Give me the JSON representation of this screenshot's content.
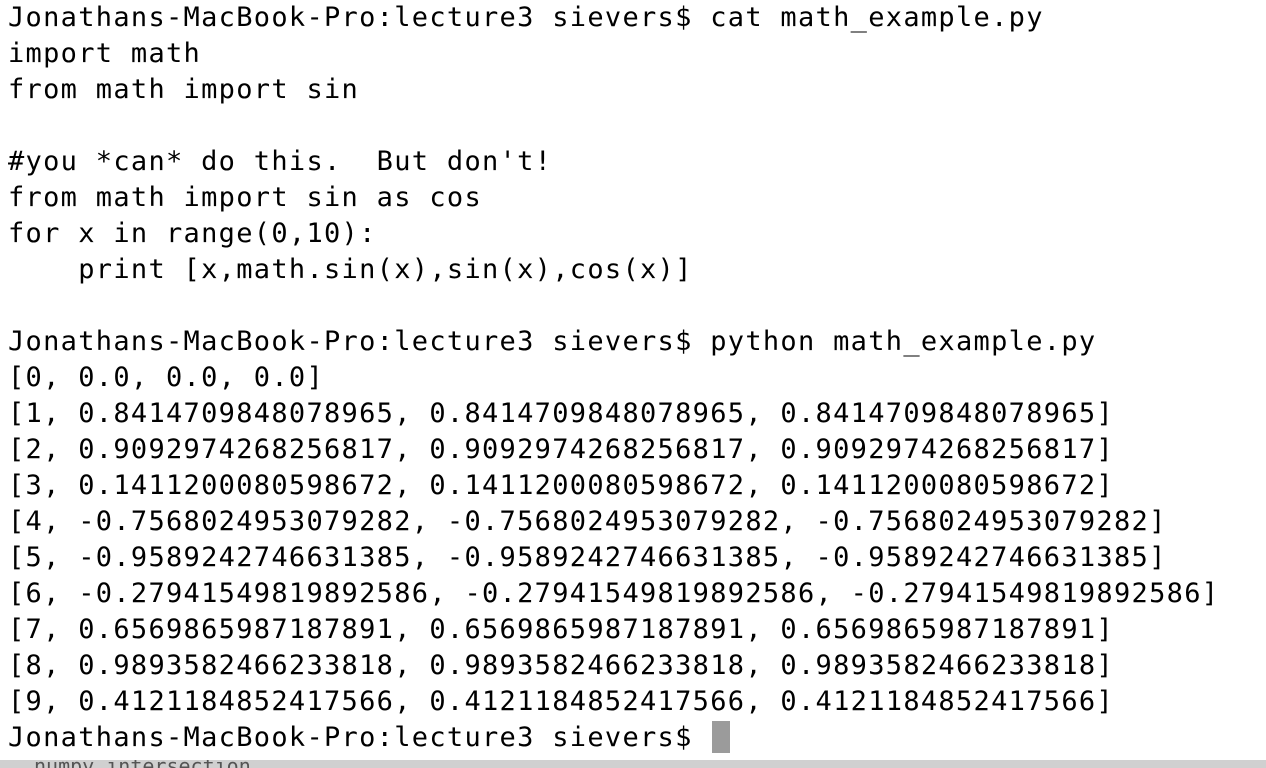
{
  "terminal": {
    "lines": [
      "Jonathans-MacBook-Pro:lecture3 sievers$ cat math_example.py",
      "import math",
      "from math import sin",
      "",
      "#you *can* do this.  But don't!",
      "from math import sin as cos",
      "for x in range(0,10):",
      "    print [x,math.sin(x),sin(x),cos(x)]",
      "",
      "Jonathans-MacBook-Pro:lecture3 sievers$ python math_example.py",
      "[0, 0.0, 0.0, 0.0]",
      "[1, 0.8414709848078965, 0.8414709848078965, 0.8414709848078965]",
      "[2, 0.9092974268256817, 0.9092974268256817, 0.9092974268256817]",
      "[3, 0.1411200080598672, 0.1411200080598672, 0.1411200080598672]",
      "[4, -0.7568024953079282, -0.7568024953079282, -0.7568024953079282]",
      "[5, -0.9589242746631385, -0.9589242746631385, -0.9589242746631385]",
      "[6, -0.27941549819892586, -0.27941549819892586, -0.27941549819892586]",
      "[7, 0.6569865987187891, 0.6569865987187891, 0.6569865987187891]",
      "[8, 0.9893582466233818, 0.9893582466233818, 0.9893582466233818]",
      "[9, 0.4121184852417566, 0.4121184852417566, 0.4121184852417566]"
    ],
    "prompt": "Jonathans-MacBook-Pro:lecture3 sievers$ ",
    "background_color": "#ffffff",
    "text_color": "#000000",
    "cursor_color": "#9b9b9b"
  },
  "bottom_edge": {
    "text": "numpy intersection"
  }
}
